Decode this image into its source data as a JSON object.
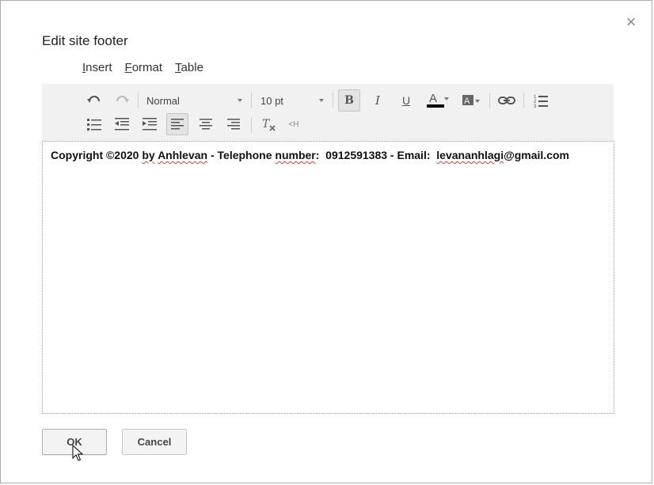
{
  "dialog": {
    "title": "Edit site footer",
    "close_glyph": "×"
  },
  "menubar": [
    {
      "accel": "I",
      "rest": "nsert"
    },
    {
      "accel": "F",
      "rest": "ormat"
    },
    {
      "accel": "T",
      "rest": "able"
    }
  ],
  "toolbar": {
    "style_value": "Normal",
    "size_value": "10 pt",
    "bold_label": "B",
    "italic_label": "I",
    "underline_label": "U",
    "text_color_label": "A",
    "html_label": "<H",
    "icons": [
      "undo-icon",
      "redo-icon",
      "bold-icon",
      "italic-icon",
      "underline-icon",
      "text-color-icon",
      "highlight-color-icon",
      "link-icon",
      "numbered-list-icon",
      "bulleted-list-icon",
      "decrease-indent-icon",
      "increase-indent-icon",
      "align-left-icon",
      "align-center-icon",
      "align-right-icon",
      "clear-formatting-icon",
      "html-source-icon"
    ],
    "active": "align-left"
  },
  "editor": {
    "p1": "Copyright ©2020 ",
    "p2": "by",
    "p3": " ",
    "p4": "Anhlevan",
    "p5": " - Telephone ",
    "p6": "number",
    "p7": ":  0912591383 - Email:  ",
    "p8": "levananhlagi",
    "p9": "@gmail.com"
  },
  "buttons": {
    "ok": "OK",
    "cancel": "Cancel"
  },
  "colors": {
    "text_color_bar": "#000000",
    "spellcheck_underline": "#e23b2e"
  }
}
